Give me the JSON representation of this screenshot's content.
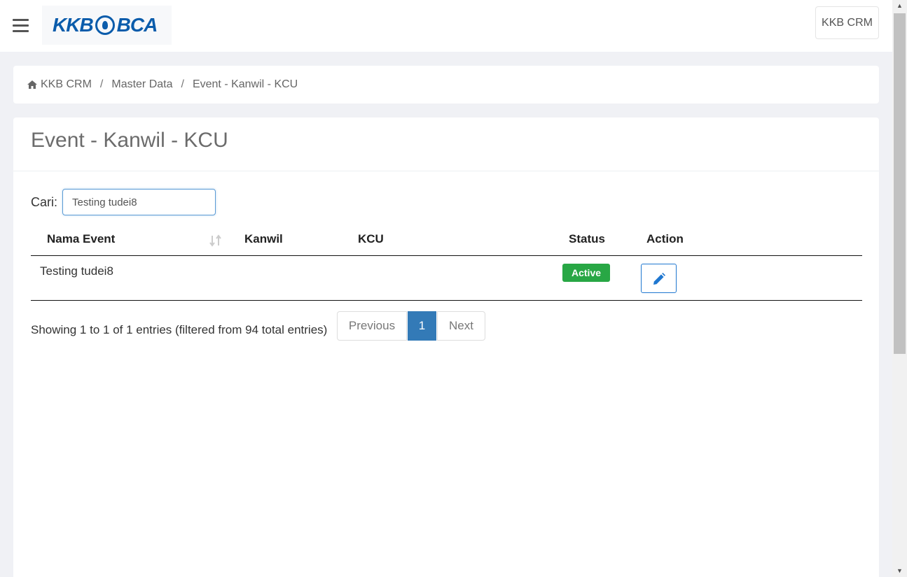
{
  "header": {
    "logo_text_left": "KKB",
    "logo_text_right": "BCA",
    "user_button": "KKB CRM"
  },
  "breadcrumb": {
    "items": [
      "KKB CRM",
      "Master Data",
      "Event - Kanwil - KCU"
    ]
  },
  "page": {
    "title": "Event - Kanwil - KCU",
    "search_label": "Cari:",
    "search_value": "Testing tudei8"
  },
  "table": {
    "columns": [
      "Nama Event",
      "Kanwil",
      "KCU",
      "Status",
      "Action"
    ],
    "rows": [
      {
        "nama_event": "Testing tudei8",
        "kanwil": "",
        "kcu": "",
        "status": "Active"
      }
    ]
  },
  "footer": {
    "info": "Showing 1 to 1 of 1 entries (filtered from 94 total entries)",
    "prev": "Previous",
    "current_page": "1",
    "next": "Next"
  },
  "colors": {
    "status_active": "#28a745",
    "pager_active": "#337ab7",
    "edit_button": "#1f77d0"
  },
  "icons": [
    "menu-icon",
    "home-icon",
    "sort-icon",
    "pencil-icon",
    "chevron-up-icon",
    "chevron-down-icon"
  ]
}
